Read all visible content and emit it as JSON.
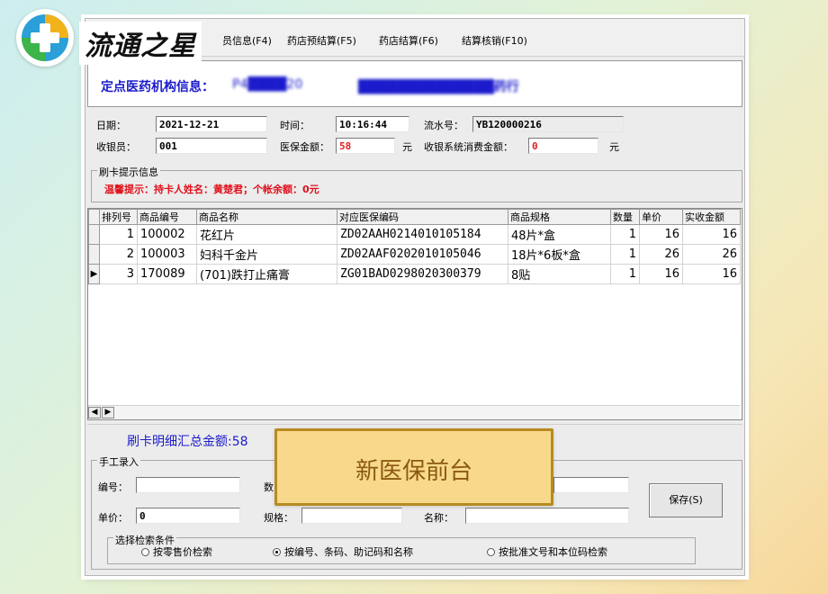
{
  "logo": {
    "text": "流通之星"
  },
  "menu": {
    "items": [
      "员信息(F4)",
      "药店预结算(F5)",
      "药店结算(F6)",
      "结算核销(F10)"
    ]
  },
  "institution": {
    "label": "定点医药机构信息：",
    "code": "P4████20",
    "name": "██████████████药行"
  },
  "form": {
    "date_label": "日期：",
    "date_value": "2021-12-21",
    "time_label": "时间：",
    "time_value": "10:16:44",
    "serial_label": "流水号：",
    "serial_value": "YB120000216",
    "cashier_label": "收银员：",
    "cashier_value": "001",
    "insurance_label": "医保金额：",
    "insurance_value": "58",
    "insurance_unit": "元",
    "cashier_consume_label": "收银系统消费金额：",
    "cashier_consume_value": "0",
    "cashier_consume_unit": "元"
  },
  "card_tip": {
    "group_title": "刷卡提示信息",
    "text": "温馨提示：持卡人姓名：黄楚君；个帐余额：0元"
  },
  "table": {
    "headers": [
      "排列号",
      "商品编号",
      "商品名称",
      "对应医保编码",
      "商品规格",
      "数量",
      "单价",
      "实收金额"
    ],
    "rows": [
      {
        "seq": "1",
        "code": "100002",
        "name": "花红片",
        "insurance_code": "ZD02AAH0214010105184",
        "spec": "48片*盒",
        "qty": "1",
        "price": "16",
        "amount": "16"
      },
      {
        "seq": "2",
        "code": "100003",
        "name": "妇科千金片",
        "insurance_code": "ZD02AAF0202010105046",
        "spec": "18片*6板*盒",
        "qty": "1",
        "price": "26",
        "amount": "26"
      },
      {
        "seq": "3",
        "code": "170089",
        "name": "(701)跌打止痛膏",
        "insurance_code": "ZG01BAD0298020300379",
        "spec": "8贴",
        "qty": "1",
        "price": "16",
        "amount": "16"
      }
    ],
    "current_row_indicator": "▶"
  },
  "summary": {
    "text": "刷卡明细汇总金额:58"
  },
  "manual": {
    "group_title": "手工录入",
    "code_label": "编号：",
    "qty_label": "数",
    "price_label": "单价：",
    "price_value": "0",
    "spec_label": "规格：",
    "name_label": "名称：",
    "save_button": "保存(S)"
  },
  "search": {
    "group_title": "选择检索条件",
    "options": [
      {
        "label": "按零售价检索",
        "selected": false
      },
      {
        "label": "按编号、条码、助记码和名称",
        "selected": true
      },
      {
        "label": "按批准文号和本位码检索",
        "selected": false
      }
    ]
  },
  "overlay": {
    "text": "新医保前台"
  },
  "colors": {
    "accent_blue": "#1b1bcc",
    "alert_red": "#e0101a",
    "overlay_bg": "#f8d98c"
  }
}
